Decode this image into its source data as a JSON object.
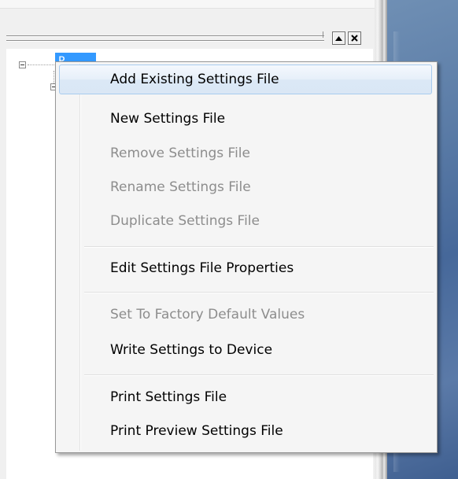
{
  "tree": {
    "root_label": "P"
  },
  "menu": {
    "items": [
      {
        "label": "Add Existing Settings File",
        "enabled": true,
        "hovered": true
      },
      {
        "label": "New Settings File",
        "enabled": true
      },
      {
        "label": "Remove Settings File",
        "enabled": false
      },
      {
        "label": "Rename Settings File",
        "enabled": false
      },
      {
        "label": "Duplicate Settings File",
        "enabled": false
      },
      {
        "label": "Edit Settings File Properties",
        "enabled": true
      },
      {
        "label": "Set To Factory Default Values",
        "enabled": false
      },
      {
        "label": "Write Settings to Device",
        "enabled": true
      },
      {
        "label": "Print Settings File",
        "enabled": true
      },
      {
        "label": "Print Preview Settings File",
        "enabled": true
      }
    ]
  },
  "colors": {
    "selection": "#3399ff",
    "menu_background": "#f5f5f5",
    "disabled_text": "#8d8d8d",
    "hover_border": "#a8cbee"
  }
}
